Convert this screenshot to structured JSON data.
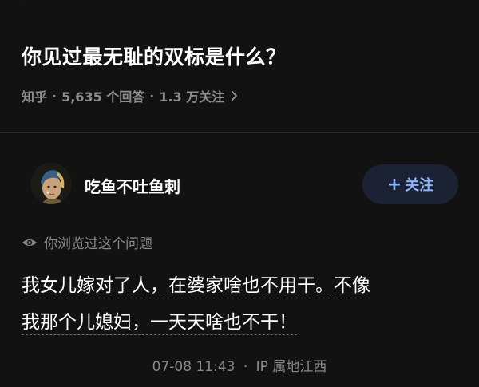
{
  "question": {
    "title": "你见过最无耻的双标是什么？",
    "meta_source": "知乎",
    "meta_answers": "5,635 个回答",
    "meta_followers": "1.3 万关注",
    "separator": "·"
  },
  "author": {
    "name": "吃鱼不吐鱼刺",
    "follow_label": "关注",
    "follow_plus": "+"
  },
  "viewed_note": "你浏览过这个问题",
  "answer": {
    "lines": [
      "我女儿嫁对了人，在婆家啥也不用干。不像",
      "我那个儿媳妇，一天天啥也不干！"
    ],
    "timestamp": "07-08 11:43",
    "ip_location": "IP 属地江西",
    "separator": "·"
  },
  "colors": {
    "background": "#121212",
    "follow_button_bg": "#1a2233",
    "follow_button_text": "#8fb4ff",
    "meta_text": "#8c8c8c"
  },
  "icons": [
    "chevron-right-icon",
    "eye-icon",
    "avatar"
  ]
}
